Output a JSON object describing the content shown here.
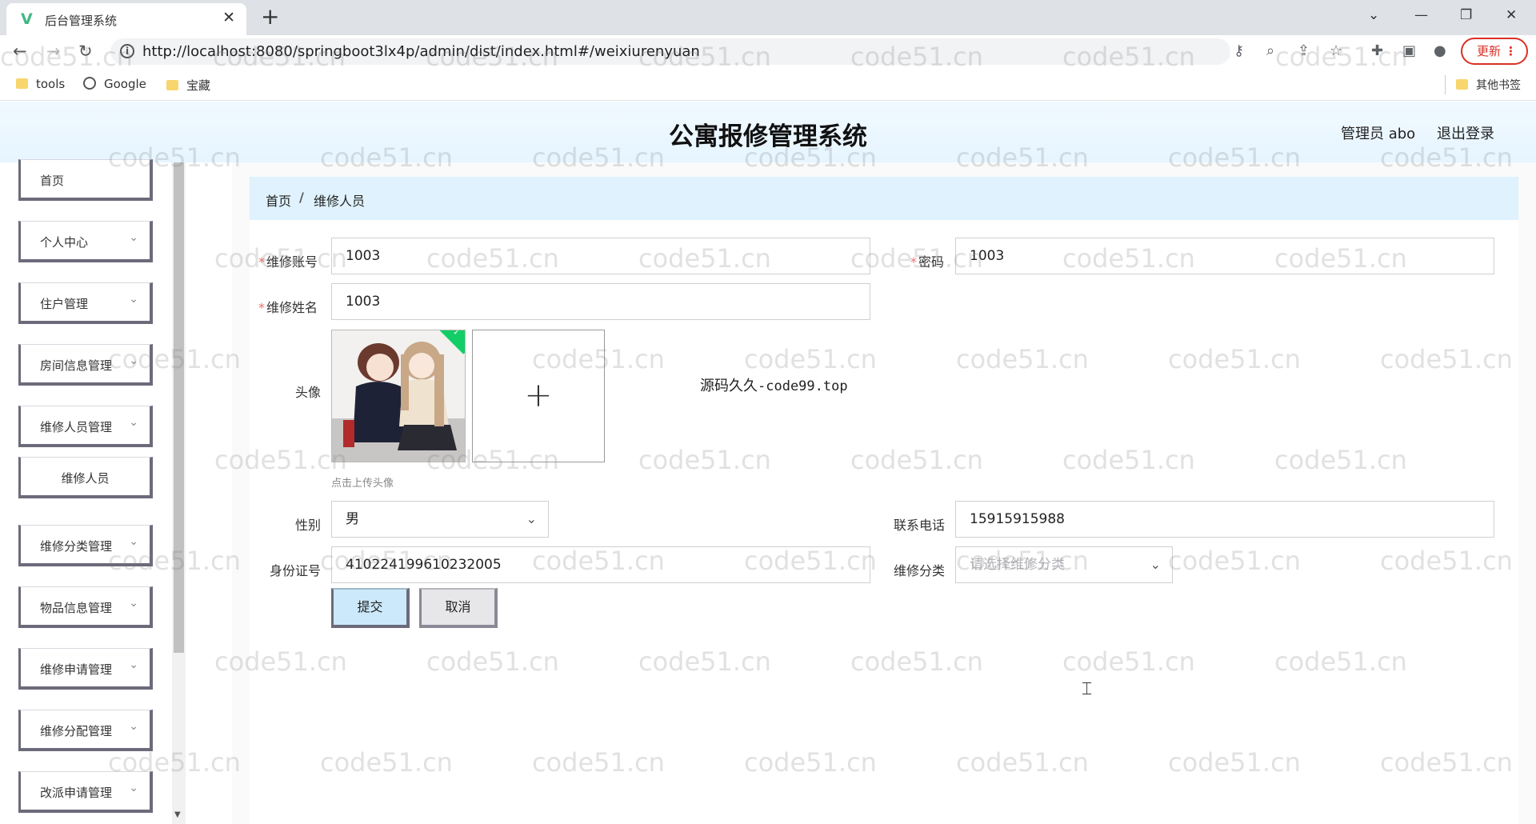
{
  "browser": {
    "tab_title": "后台管理系统",
    "tab_logo": "V",
    "url": "http://localhost:8080/springboot3lx4p/admin/dist/index.html#/weixiurenyuan",
    "update_label": "更新",
    "bookmarks": [
      "tools",
      "Google",
      "宝藏"
    ],
    "other_bookmarks": "其他书签"
  },
  "app": {
    "title": "公寓报修管理系统",
    "user_label": "管理员 abo",
    "logout_label": "退出登录"
  },
  "sidebar": {
    "items": [
      {
        "label": "首页"
      },
      {
        "label": "个人中心"
      },
      {
        "label": "住户管理"
      },
      {
        "label": "房间信息管理"
      },
      {
        "label": "维修人员管理"
      },
      {
        "label": "维修人员"
      },
      {
        "label": "维修分类管理"
      },
      {
        "label": "物品信息管理"
      },
      {
        "label": "维修申请管理"
      },
      {
        "label": "维修分配管理"
      },
      {
        "label": "改派申请管理"
      }
    ]
  },
  "breadcrumb": {
    "home": "首页",
    "sep": "/",
    "current": "维修人员"
  },
  "form": {
    "account_label": "维修账号",
    "account_value": "1003",
    "password_label": "密码",
    "password_value": "1003",
    "name_label": "维修姓名",
    "name_value": "1003",
    "avatar_label": "头像",
    "upload_note": "点击上传头像",
    "promo_text": "源码久久",
    "promo_mono": "-code99.top",
    "gender_label": "性别",
    "gender_value": "男",
    "phone_label": "联系电话",
    "phone_value": "15915915988",
    "id_label": "身份证号",
    "id_value": "410224199610232005",
    "category_label": "维修分类",
    "category_placeholder": "请选择维修分类",
    "submit_label": "提交",
    "cancel_label": "取消"
  },
  "watermark": "code51.cn",
  "colors": {
    "header_bg": "#e6f5ff",
    "breadcrumb_bg": "#dff2fd",
    "submit_bg": "#cbe9fa",
    "required": "#f56c6c",
    "upload_success": "#13ce66"
  }
}
